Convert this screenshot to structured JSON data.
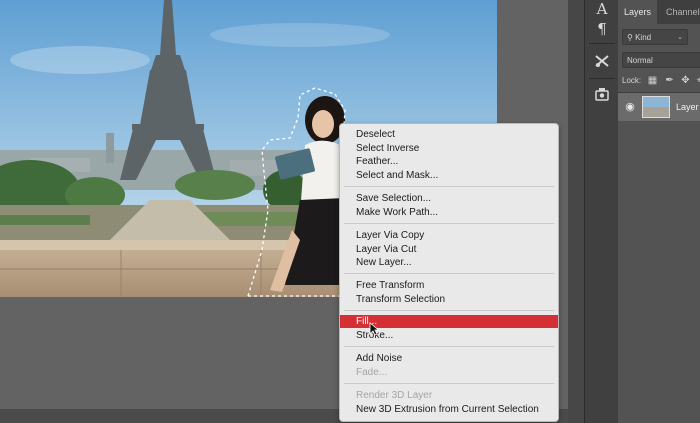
{
  "panel": {
    "tabs": [
      "Layers",
      "Channels"
    ],
    "kind_filter": "Kind",
    "blend_mode": "Normal",
    "lock_label": "Lock:",
    "layer_name": "Layer"
  },
  "tools": {
    "type_icon": "A",
    "paragraph_icon": "¶"
  },
  "context_menu": {
    "items": [
      "Deselect",
      "Select Inverse",
      "Feather...",
      "Select and Mask...",
      "Save Selection...",
      "Make Work Path...",
      "Layer Via Copy",
      "Layer Via Cut",
      "New Layer...",
      "Free Transform",
      "Transform Selection",
      "Fill...",
      "Stroke...",
      "Add Noise",
      "Fade...",
      "Render 3D Layer",
      "New 3D Extrusion from Current Selection"
    ],
    "highlighted": "Fill...",
    "highlight_color": "#d42f35",
    "disabled": [
      "Fade...",
      "Render 3D Layer"
    ]
  }
}
